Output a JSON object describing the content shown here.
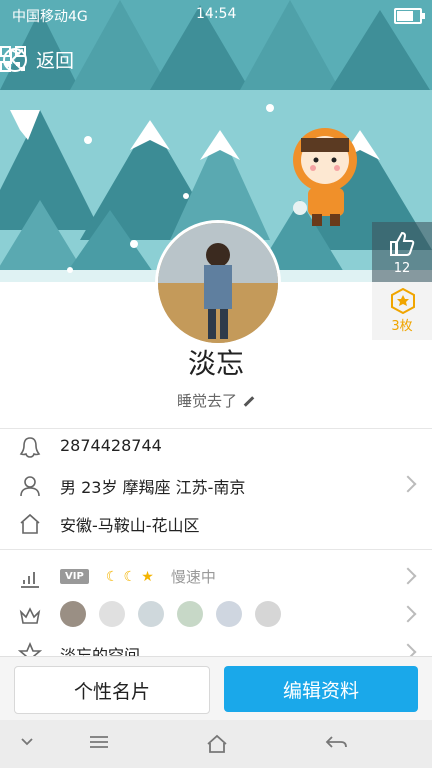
{
  "status_bar": {
    "carrier": "中国移动4G",
    "time": "14:54"
  },
  "nav": {
    "back_label": "返回"
  },
  "side": {
    "likes": "12",
    "medals": "3枚"
  },
  "profile": {
    "name": "淡忘",
    "signature": "睡觉去了"
  },
  "info": {
    "qq": "2874428744",
    "basic": "男  23岁  摩羯座  江苏-南京",
    "hometown": "安徽-马鞍山-花山区"
  },
  "level": {
    "vip_label": "VIP",
    "speed_text": "慢速中"
  },
  "space": {
    "label": "淡忘的空间"
  },
  "buttons": {
    "card": "个性名片",
    "edit": "编辑资料"
  },
  "colors": {
    "accent": "#1aa8ea",
    "banner": "#7ec9cf"
  }
}
